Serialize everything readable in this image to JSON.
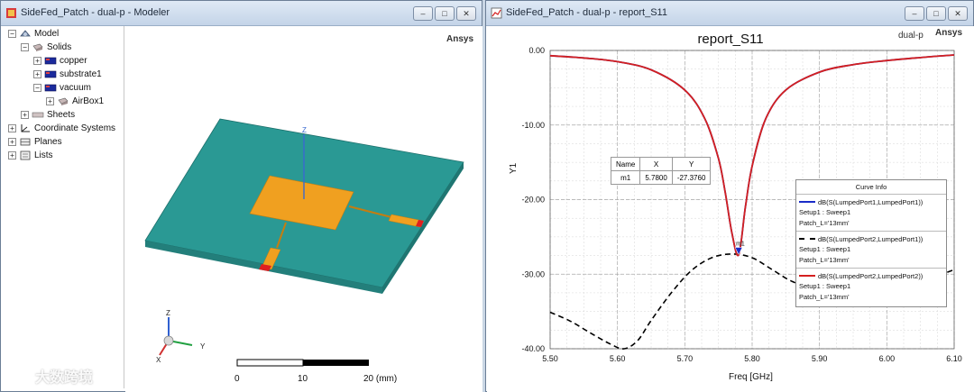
{
  "left_window": {
    "title": "SideFed_Patch - dual-p - Modeler",
    "buttons": [
      "–",
      "□",
      "✕"
    ],
    "brand": "Ansys",
    "tree": {
      "model": "Model",
      "solids": "Solids",
      "copper": "copper",
      "substrate": "substrate1",
      "vacuum": "vacuum",
      "airbox": "AirBox1",
      "sheets": "Sheets",
      "coordinate_systems": "Coordinate Systems",
      "planes": "Planes",
      "lists": "Lists"
    },
    "axes": {
      "z": "Z",
      "y": "Y",
      "x": "X"
    },
    "scale": {
      "t0": "0",
      "t1": "10",
      "t2": "20 (mm)"
    },
    "colors": {
      "substrate": "#2a9994",
      "patch": "#f0a020",
      "port": "#e02020"
    }
  },
  "right_window": {
    "title": "SideFed_Patch - dual-p - report_S11",
    "buttons": [
      "–",
      "□",
      "✕"
    ],
    "design": "dual-p",
    "brand": "Ansys",
    "marker_table": {
      "headers": [
        "Name",
        "X",
        "Y"
      ],
      "row": [
        "m1",
        "5.7800",
        "-27.3760"
      ]
    },
    "marker_label": "m1",
    "curve_info": {
      "title": "Curve Info",
      "entries": [
        {
          "expr": "dB(S(LumpedPort1,LumpedPort1))",
          "setup": "Setup1 : Sweep1",
          "param": "Patch_L='13mm'",
          "color": "#1a2cc8",
          "style": "solid"
        },
        {
          "expr": "dB(S(LumpedPort2,LumpedPort1))",
          "setup": "Setup1 : Sweep1",
          "param": "Patch_L='13mm'",
          "color": "#000000",
          "style": "dashed"
        },
        {
          "expr": "dB(S(LumpedPort2,LumpedPort2))",
          "setup": "Setup1 : Sweep1",
          "param": "Patch_L='13mm'",
          "color": "#d42020",
          "style": "solid"
        }
      ]
    }
  },
  "watermark": "大数跨境",
  "chart_data": {
    "type": "line",
    "title": "report_S11",
    "xlabel": "Freq [GHz]",
    "ylabel": "Y1",
    "xlim": [
      5.5,
      6.1
    ],
    "ylim": [
      -40,
      0
    ],
    "xticks": [
      "5.50",
      "5.60",
      "5.70",
      "5.80",
      "5.90",
      "6.00",
      "6.10"
    ],
    "yticks": [
      "0.00",
      "-10.00",
      "-20.00",
      "-30.00",
      "-40.00"
    ],
    "grid": true,
    "series": [
      {
        "name": "dB(S(LumpedPort1,LumpedPort1))",
        "color": "#1a2cc8",
        "style": "solid",
        "x": [
          5.5,
          5.55,
          5.6,
          5.65,
          5.7,
          5.73,
          5.75,
          5.76,
          5.77,
          5.78,
          5.79,
          5.8,
          5.82,
          5.85,
          5.9,
          5.95,
          6.0,
          6.05,
          6.1
        ],
        "y": [
          -0.7,
          -1.0,
          -1.5,
          -2.6,
          -5.3,
          -9.2,
          -14.5,
          -19.0,
          -24.5,
          -27.4,
          -21.0,
          -15.5,
          -9.2,
          -5.3,
          -2.9,
          -1.9,
          -1.35,
          -0.95,
          -0.6
        ]
      },
      {
        "name": "dB(S(LumpedPort2,LumpedPort1))",
        "color": "#000000",
        "style": "dashed",
        "x": [
          5.5,
          5.53,
          5.56,
          5.59,
          5.61,
          5.63,
          5.65,
          5.68,
          5.71,
          5.74,
          5.77,
          5.8,
          5.83,
          5.86,
          5.9,
          5.95,
          6.0,
          6.05,
          6.1
        ],
        "y": [
          -35.1,
          -36.3,
          -37.9,
          -39.4,
          -40.0,
          -38.9,
          -36.2,
          -32.5,
          -29.5,
          -27.8,
          -27.3,
          -27.8,
          -29.4,
          -31.0,
          -32.2,
          -32.8,
          -32.4,
          -31.0,
          -29.4
        ]
      },
      {
        "name": "dB(S(LumpedPort2,LumpedPort2))",
        "color": "#d42020",
        "style": "solid",
        "x": [
          5.5,
          5.55,
          5.6,
          5.65,
          5.7,
          5.73,
          5.75,
          5.76,
          5.77,
          5.78,
          5.79,
          5.8,
          5.82,
          5.85,
          5.9,
          5.95,
          6.0,
          6.05,
          6.1
        ],
        "y": [
          -0.7,
          -1.0,
          -1.5,
          -2.6,
          -5.3,
          -9.2,
          -14.5,
          -19.0,
          -24.5,
          -27.4,
          -21.0,
          -15.5,
          -9.2,
          -5.3,
          -2.9,
          -1.9,
          -1.35,
          -0.95,
          -0.6
        ]
      }
    ],
    "marker": {
      "name": "m1",
      "x": 5.78,
      "y": -27.376
    }
  }
}
